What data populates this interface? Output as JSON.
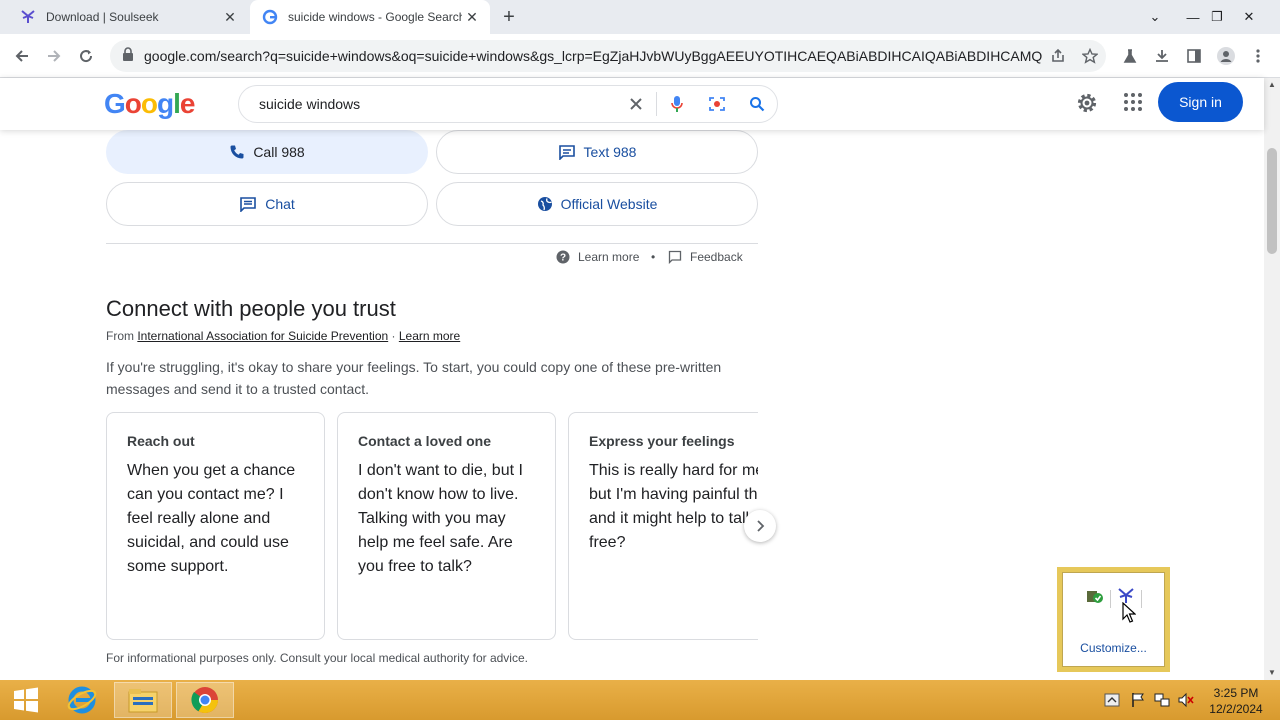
{
  "browser": {
    "tabs": [
      {
        "title": "Download | Soulseek"
      },
      {
        "title": "suicide windows - Google Search"
      }
    ],
    "url": "google.com/search?q=suicide+windows&oq=suicide+windows&gs_lcrp=EgZjaHJvbWUyBggAEEUYOTIHCAEQABiABDIHCAIQABiABDIHCAMQA..."
  },
  "google": {
    "logo": "Google",
    "query": "suicide windows",
    "signin_label": "Sign in"
  },
  "helpline": {
    "call_label": "Call 988",
    "text_label": "Text 988",
    "chat_label": "Chat",
    "website_label": "Official Website",
    "learn_more": "Learn more",
    "separator": "•",
    "feedback": "Feedback"
  },
  "connect": {
    "heading": "Connect with people you trust",
    "from_prefix": "From ",
    "source": "International Association for Suicide Prevention",
    "source_sep": " · ",
    "learn_more": "Learn more",
    "description": "If you're struggling, it's okay to share your feelings. To start, you could copy one of these pre-written messages and send it to a trusted contact.",
    "cards": [
      {
        "heading": "Reach out",
        "body": "When you get a chance can you contact me? I feel really alone and suicidal, and could use some support."
      },
      {
        "heading": "Contact a loved one",
        "body": "I don't want to die, but I don't know how to live. Talking with you may help me feel safe. Are you free to talk?"
      },
      {
        "heading": "Express your feelings",
        "body": "This is really hard for me to say but I'm having painful thoughts and it might help to talk. Are you free?"
      }
    ],
    "disclaimer": "For informational purposes only. Consult your local medical authority for advice."
  },
  "tray_popup": {
    "customize_label": "Customize..."
  },
  "taskbar": {
    "time": "3:25 PM",
    "date": "12/2/2024"
  }
}
